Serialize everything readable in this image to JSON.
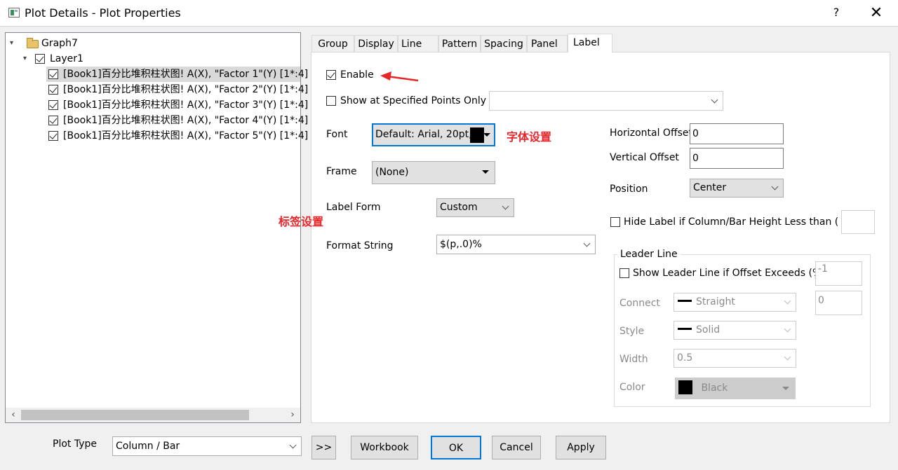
{
  "window": {
    "title": "Plot Details - Plot Properties",
    "help": "?",
    "close": "✕"
  },
  "tree": {
    "graph": "Graph7",
    "layer": "Layer1",
    "items": [
      "[Book1]百分比堆积柱状图! A(X), \"Factor 1\"(Y) [1*:4]",
      "[Book1]百分比堆积柱状图! A(X), \"Factor 2\"(Y) [1*:4]",
      "[Book1]百分比堆积柱状图! A(X), \"Factor 3\"(Y) [1*:4]",
      "[Book1]百分比堆积柱状图! A(X), \"Factor 4\"(Y) [1*:4]",
      "[Book1]百分比堆积柱状图! A(X), \"Factor 5\"(Y) [1*:4]"
    ]
  },
  "tabs": [
    "Group",
    "Display",
    "Line",
    "Pattern",
    "Spacing",
    "Panel",
    "Label"
  ],
  "label_tab": {
    "enable": "Enable",
    "show_specified": "Show at Specified Points Only",
    "specified_value": "",
    "font_label": "Font",
    "font_value": "Default: Arial, 20pt,",
    "frame_label": "Frame",
    "frame_value": "(None)",
    "label_form_label": "Label Form",
    "label_form_value": "Custom",
    "format_string_label": "Format String",
    "format_string_value": "$(p,.0)%",
    "h_offset_label": "Horizontal Offset",
    "h_offset_value": "0",
    "v_offset_label": "Vertical Offset",
    "v_offset_value": "0",
    "position_label": "Position",
    "position_value": "Center",
    "hide_label": "Hide Label if Column/Bar Height Less than (%)",
    "hide_value": "",
    "leader": {
      "title": "Leader Line",
      "show": "Show Leader Line if Offset Exceeds (%)",
      "show_value": "-1",
      "connect_label": "Connect",
      "connect_value": "Straight",
      "connect_extra": "0",
      "style_label": "Style",
      "style_value": "Solid",
      "width_label": "Width",
      "width_value": "0.5",
      "color_label": "Color",
      "color_value": "Black"
    }
  },
  "annotations": {
    "font_note": "字体设置",
    "label_note": "标签设置"
  },
  "footer": {
    "plot_type_label": "Plot Type",
    "plot_type_value": "Column / Bar",
    "more": ">>",
    "workbook": "Workbook",
    "ok": "OK",
    "cancel": "Cancel",
    "apply": "Apply"
  },
  "colors": {
    "annotation": "#e8262a",
    "focus": "#0078d7"
  }
}
